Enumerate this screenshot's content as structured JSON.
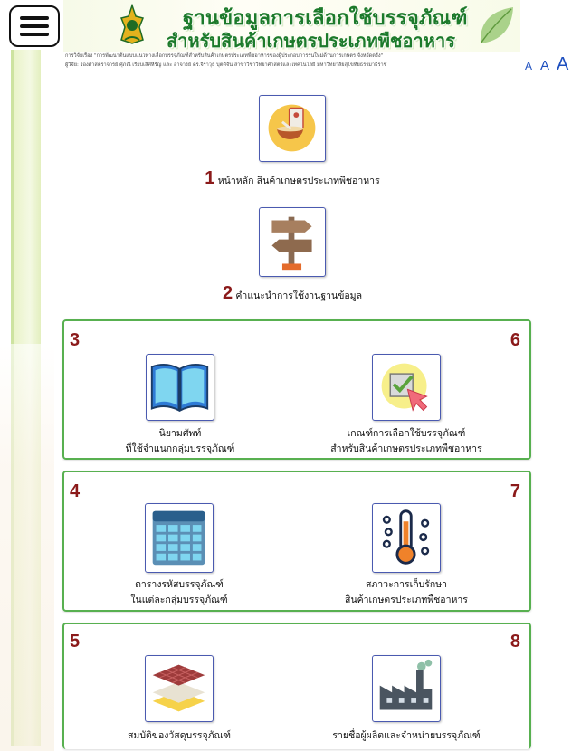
{
  "header": {
    "title_line1": "ฐานข้อมูลการเลือกใช้บรรจุภัณฑ์",
    "title_line2": "สำหรับสินค้าเกษตรประเภทพืชอาหาร",
    "credit_line1": "การวิจัยเรื่อง \"การพัฒนาต้นแบบแนวทางเลือกบรรจุภัณฑ์สำหรับสินค้าเกษตรประเภทพืชอาหารของผู้ประกอบการรุ่นใหม่ด้านการเกษตร จังหวัดตรัง\"",
    "credit_line2": "ผู้วิจัย: รองศาสตราจารย์ ศุภณี เรียบเลิศหิรัญ และ อาจารย์ ดร.จิราวุธ บุตดีจัน สาขาวิชาวิทยาศาสตร์และเทคโนโลยี มหาวิทยาลัยสุโขทัยธรรมาธิราช",
    "font_small": "A",
    "font_medium": "A",
    "font_large": "A"
  },
  "items": {
    "home": {
      "num": "1",
      "label": "หน้าหลัก สินค้าเกษตรประเภทพืชอาหาร"
    },
    "guide": {
      "num": "2",
      "label": "คำแนะนำการใช้งานฐานข้อมูล"
    },
    "g3": {
      "num": "3",
      "line1": "นิยามศัพท์",
      "line2": "ที่ใช้จำแนกกลุ่มบรรจุภัณฑ์"
    },
    "g6": {
      "num": "6",
      "line1": "เกณฑ์การเลือกใช้บรรจุภัณฑ์",
      "line2": "สำหรับสินค้าเกษตรประเภทพืชอาหาร"
    },
    "g4": {
      "num": "4",
      "line1": "ตารางรหัสบรรจุภัณฑ์",
      "line2": "ในแต่ละกลุ่มบรรจุภัณฑ์"
    },
    "g7": {
      "num": "7",
      "line1": "สภาวะการเก็บรักษา",
      "line2": "สินค้าเกษตรประเภทพืชอาหาร"
    },
    "g5": {
      "num": "5",
      "line1": "สมบัติของวัสดุบรรจุภัณฑ์"
    },
    "g8": {
      "num": "8",
      "line1": "รายชื่อผู้ผลิตและจำหน่ายบรรจุภัณฑ์"
    }
  },
  "colors": {
    "title_green": "#1c7a2b",
    "number_red": "#8b1a1a",
    "group_border": "#58b050",
    "tile_border": "#4a5ab0",
    "font_link": "#1e4fbf"
  }
}
